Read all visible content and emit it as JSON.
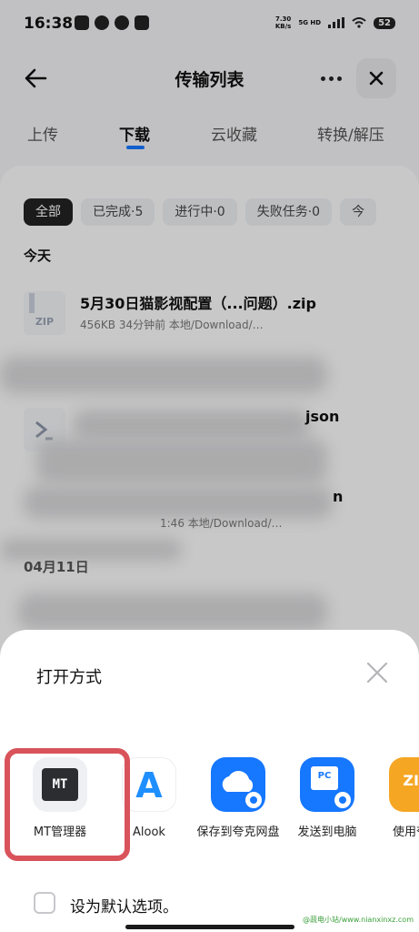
{
  "status_bar": {
    "time": "16:38",
    "speed_value": "7.30",
    "speed_unit": "KB/s",
    "network": "5G HD",
    "battery": "52"
  },
  "header": {
    "title": "传输列表"
  },
  "tabs": [
    {
      "label": "上传",
      "active": false
    },
    {
      "label": "下载",
      "active": true
    },
    {
      "label": "云收藏",
      "active": false
    },
    {
      "label": "转换/解压",
      "active": false
    }
  ],
  "filters": [
    {
      "label": "全部",
      "active": true
    },
    {
      "label": "已完成·5",
      "active": false
    },
    {
      "label": "进行中·0",
      "active": false
    },
    {
      "label": "失败任务·0",
      "active": false
    },
    {
      "label": "今",
      "active": false
    }
  ],
  "sections": {
    "today": "今天",
    "april": "04月11日"
  },
  "files": [
    {
      "name": "5月30日猫影视配置（...问题）.zip",
      "meta": "456KB  34分钟前  本地/Download/…",
      "icon_label": "ZIP"
    },
    {
      "name": "json",
      "meta": "",
      "icon": "terminal-icon"
    },
    {
      "name": "n",
      "meta": "1:46  本地/Download/…"
    }
  ],
  "sheet": {
    "title": "打开方式",
    "apps": [
      {
        "label": "MT管理器",
        "icon_text": "MT",
        "color": "#2b2d31",
        "highlighted": true
      },
      {
        "label": "Alook",
        "icon_text": "A",
        "color": "#1f8fff"
      },
      {
        "label": "保存到夸克网盘",
        "icon": "cloud-icon",
        "color": "#1677ff"
      },
      {
        "label": "发送到电脑",
        "icon_text": "PC",
        "color": "#1677ff"
      },
      {
        "label": "使用夸压",
        "icon_text": "ZIP",
        "color": "#f5a623"
      }
    ],
    "default_option": "设为默认选项。"
  },
  "watermark": "@蔬电小站/www.nianxinxz.com"
}
